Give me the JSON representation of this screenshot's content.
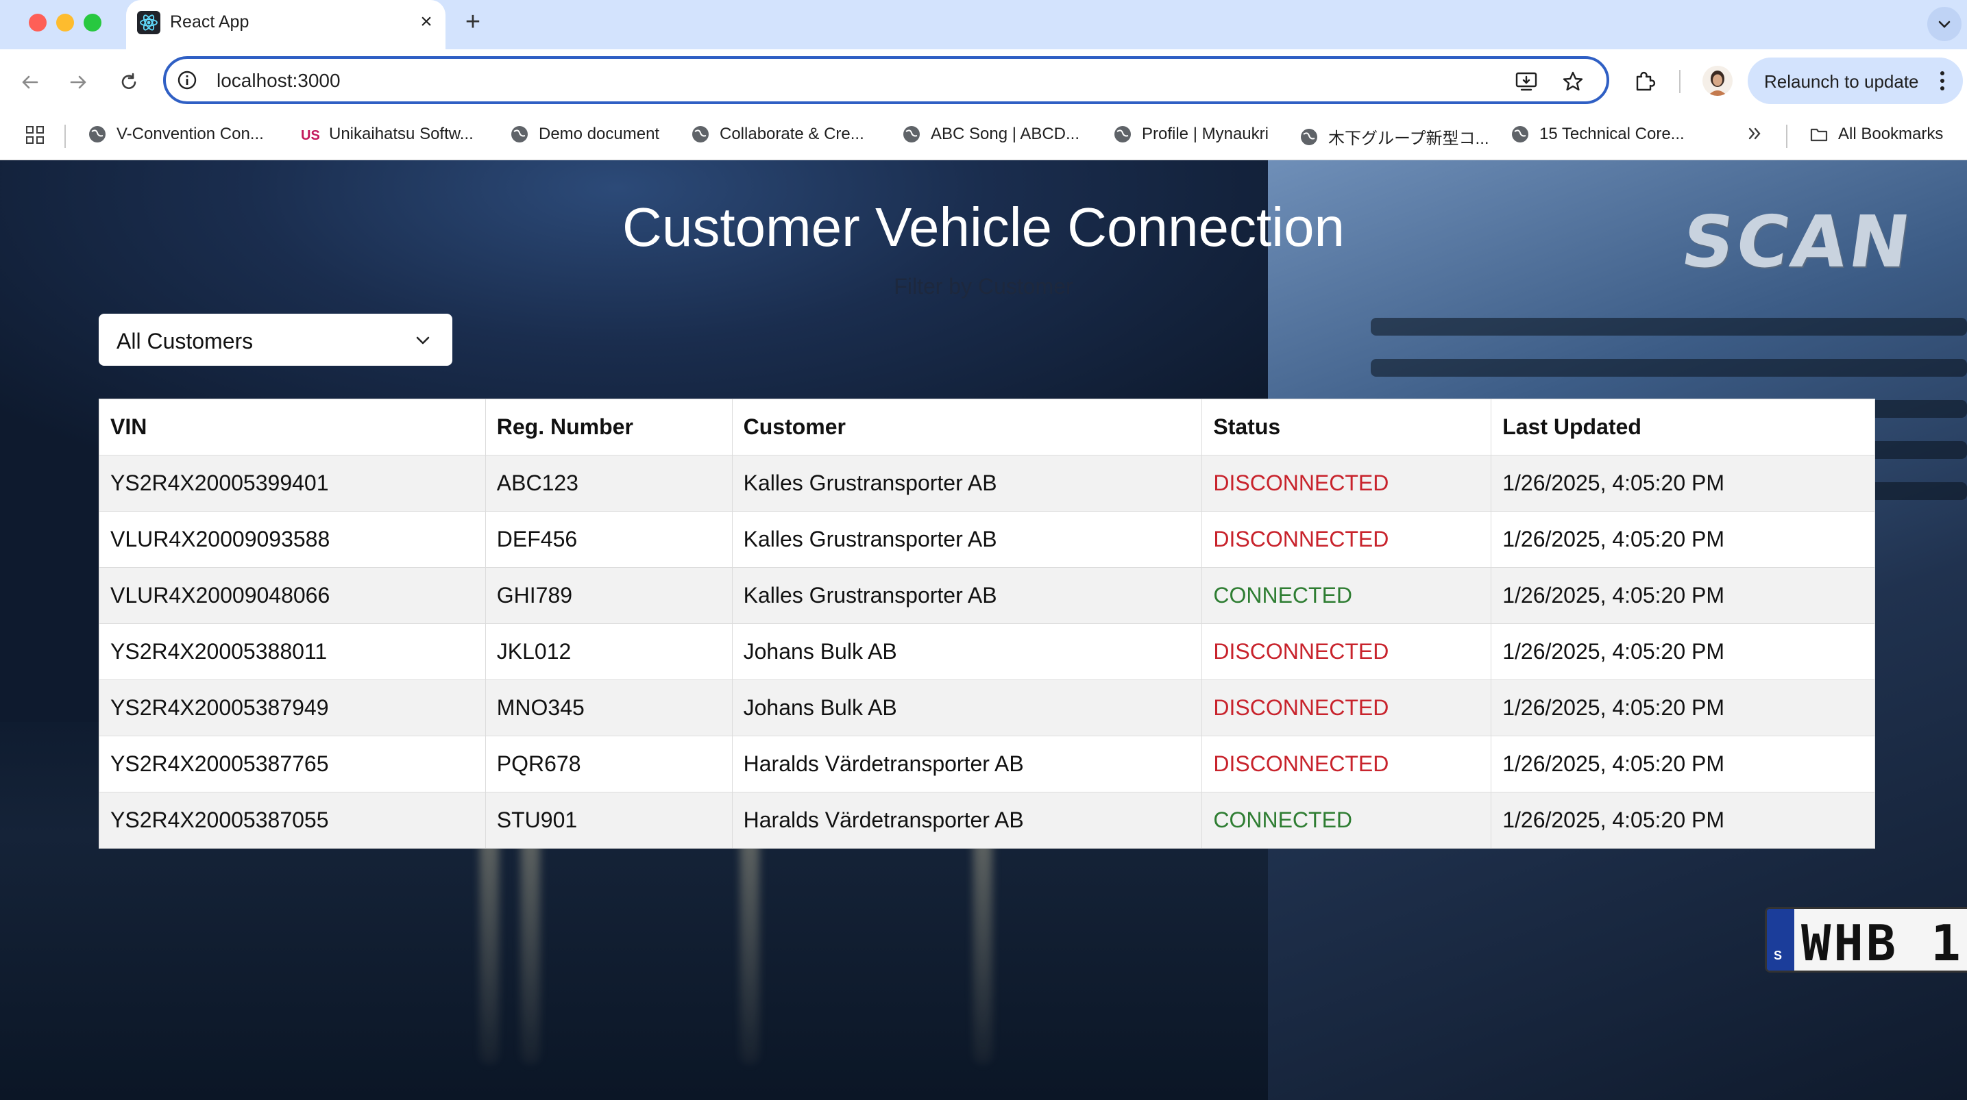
{
  "browser": {
    "tab_title": "React App",
    "url": "localhost:3000",
    "relaunch_label": "Relaunch to update",
    "bookmarks": [
      {
        "label": "V-Convention Con...",
        "icon": "globe-icon"
      },
      {
        "label": "Unikaihatsu Softw...",
        "icon": "us-logo-icon"
      },
      {
        "label": "Demo document",
        "icon": "globe-icon"
      },
      {
        "label": "Collaborate & Cre...",
        "icon": "globe-icon"
      },
      {
        "label": "ABC Song | ABCD...",
        "icon": "globe-icon"
      },
      {
        "label": "Profile | Mynaukri",
        "icon": "globe-icon"
      },
      {
        "label": "木下グループ新型コ...",
        "icon": "globe-icon"
      },
      {
        "label": "15 Technical Core...",
        "icon": "globe-icon"
      }
    ],
    "all_bookmarks_label": "All Bookmarks"
  },
  "page": {
    "title": "Customer Vehicle Connection",
    "filter_label": "Filter by Customer",
    "filter_select": {
      "selected": "All Customers"
    },
    "table": {
      "columns": [
        "VIN",
        "Reg. Number",
        "Customer",
        "Status",
        "Last Updated"
      ],
      "rows": [
        {
          "vin": "YS2R4X20005399401",
          "reg": "ABC123",
          "customer": "Kalles Grustransporter AB",
          "status": "DISCONNECTED",
          "updated": "1/26/2025, 4:05:20 PM"
        },
        {
          "vin": "VLUR4X20009093588",
          "reg": "DEF456",
          "customer": "Kalles Grustransporter AB",
          "status": "DISCONNECTED",
          "updated": "1/26/2025, 4:05:20 PM"
        },
        {
          "vin": "VLUR4X20009048066",
          "reg": "GHI789",
          "customer": "Kalles Grustransporter AB",
          "status": "CONNECTED",
          "updated": "1/26/2025, 4:05:20 PM"
        },
        {
          "vin": "YS2R4X20005388011",
          "reg": "JKL012",
          "customer": "Johans Bulk AB",
          "status": "DISCONNECTED",
          "updated": "1/26/2025, 4:05:20 PM"
        },
        {
          "vin": "YS2R4X20005387949",
          "reg": "MNO345",
          "customer": "Johans Bulk AB",
          "status": "DISCONNECTED",
          "updated": "1/26/2025, 4:05:20 PM"
        },
        {
          "vin": "YS2R4X20005387765",
          "reg": "PQR678",
          "customer": "Haralds Värdetransporter AB",
          "status": "DISCONNECTED",
          "updated": "1/26/2025, 4:05:20 PM"
        },
        {
          "vin": "YS2R4X20005387055",
          "reg": "STU901",
          "customer": "Haralds Värdetransporter AB",
          "status": "CONNECTED",
          "updated": "1/26/2025, 4:05:20 PM"
        }
      ]
    },
    "background": {
      "truck_logo": "SCAN",
      "plate_country": "S",
      "plate_text": "WHB 1"
    }
  },
  "colors": {
    "disconnected": "#c8232c",
    "connected": "#2e7d32",
    "accent": "#2f5fc4"
  }
}
